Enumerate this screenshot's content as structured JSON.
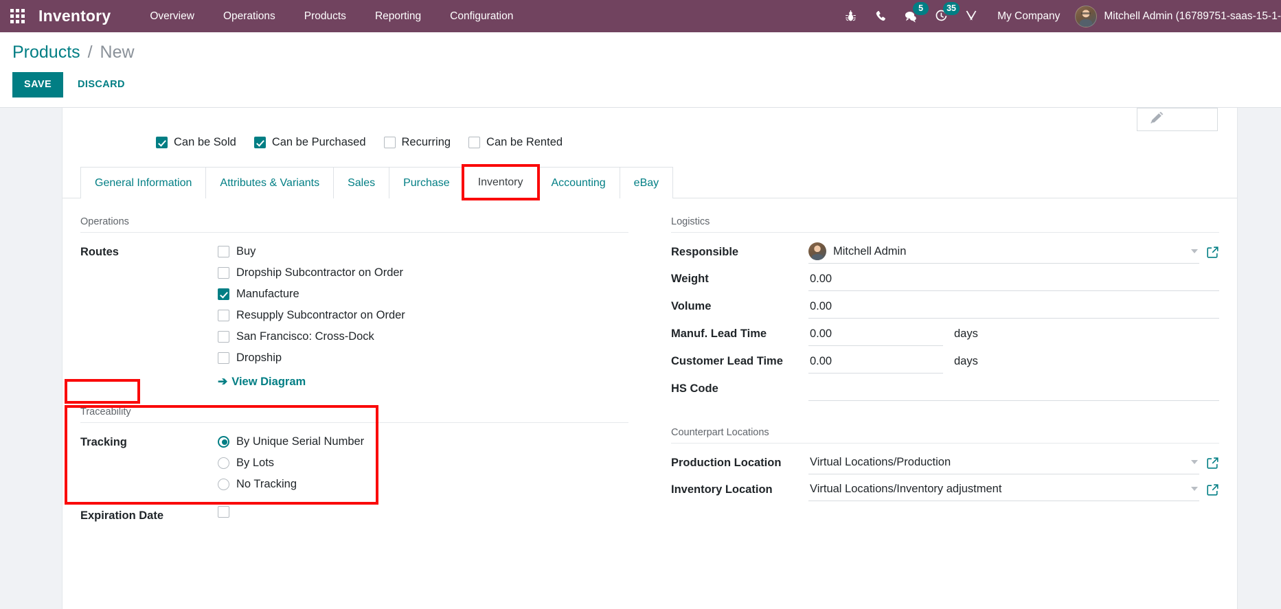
{
  "navbar": {
    "apps_icon": "apps-grid-icon",
    "brand": "Inventory",
    "menu": [
      {
        "label": "Overview"
      },
      {
        "label": "Operations"
      },
      {
        "label": "Products"
      },
      {
        "label": "Reporting"
      },
      {
        "label": "Configuration"
      }
    ],
    "icons": [
      {
        "name": "bug-icon",
        "badge": null
      },
      {
        "name": "phone-icon",
        "badge": null
      },
      {
        "name": "chat-icon",
        "badge": "5"
      },
      {
        "name": "activity-clock-icon",
        "badge": "35"
      },
      {
        "name": "tools-icon",
        "badge": null
      }
    ],
    "company": "My Company",
    "user_name": "Mitchell Admin (16789751-saas-15-1-",
    "accent_color": "#71435f",
    "badge_color": "#017e84"
  },
  "control_panel": {
    "breadcrumb_root": "Products",
    "breadcrumb_separator": "/",
    "breadcrumb_current": "New",
    "save_label": "SAVE",
    "discard_label": "DISCARD",
    "primary_color": "#017e84"
  },
  "form": {
    "image_placeholder_icon": "pencil-edit-icon",
    "flags": [
      {
        "label": "Can be Sold",
        "checked": true
      },
      {
        "label": "Can be Purchased",
        "checked": true
      },
      {
        "label": "Recurring",
        "checked": false
      },
      {
        "label": "Can be Rented",
        "checked": false
      }
    ],
    "tabs": [
      {
        "label": "General Information",
        "active": false,
        "highlighted": false
      },
      {
        "label": "Attributes & Variants",
        "active": false,
        "highlighted": false
      },
      {
        "label": "Sales",
        "active": false,
        "highlighted": false
      },
      {
        "label": "Purchase",
        "active": false,
        "highlighted": false
      },
      {
        "label": "Inventory",
        "active": true,
        "highlighted": true
      },
      {
        "label": "Accounting",
        "active": false,
        "highlighted": false
      },
      {
        "label": "eBay",
        "active": false,
        "highlighted": false
      }
    ],
    "operations": {
      "title": "Operations",
      "routes_label": "Routes",
      "routes": [
        {
          "label": "Buy",
          "checked": false
        },
        {
          "label": "Dropship Subcontractor on Order",
          "checked": false
        },
        {
          "label": "Manufacture",
          "checked": true
        },
        {
          "label": "Resupply Subcontractor on Order",
          "checked": false
        },
        {
          "label": "San Francisco: Cross-Dock",
          "checked": false
        },
        {
          "label": "Dropship",
          "checked": false
        }
      ],
      "view_diagram_label": "View Diagram",
      "view_diagram_arrow": "➔"
    },
    "traceability": {
      "title": "Traceability",
      "tracking_label": "Tracking",
      "tracking_options": [
        {
          "label": "By Unique Serial Number",
          "selected": true
        },
        {
          "label": "By Lots",
          "selected": false
        },
        {
          "label": "No Tracking",
          "selected": false
        }
      ],
      "expiration_label": "Expiration Date",
      "expiration_checked": false
    },
    "logistics": {
      "title": "Logistics",
      "responsible_label": "Responsible",
      "responsible_value": "Mitchell Admin",
      "weight_label": "Weight",
      "weight_value": "0.00",
      "volume_label": "Volume",
      "volume_value": "0.00",
      "manuf_lead_label": "Manuf. Lead Time",
      "manuf_lead_value": "0.00",
      "manuf_lead_unit": "days",
      "customer_lead_label": "Customer Lead Time",
      "customer_lead_value": "0.00",
      "customer_lead_unit": "days",
      "hs_code_label": "HS Code",
      "hs_code_value": ""
    },
    "counterpart": {
      "title": "Counterpart Locations",
      "production_label": "Production Location",
      "production_value": "Virtual Locations/Production",
      "inventory_label": "Inventory Location",
      "inventory_value": "Virtual Locations/Inventory adjustment"
    }
  },
  "annotations": {
    "color": "#fa0a0a",
    "boxes": [
      "inventory-tab",
      "traceability-title",
      "tracking-group"
    ]
  }
}
